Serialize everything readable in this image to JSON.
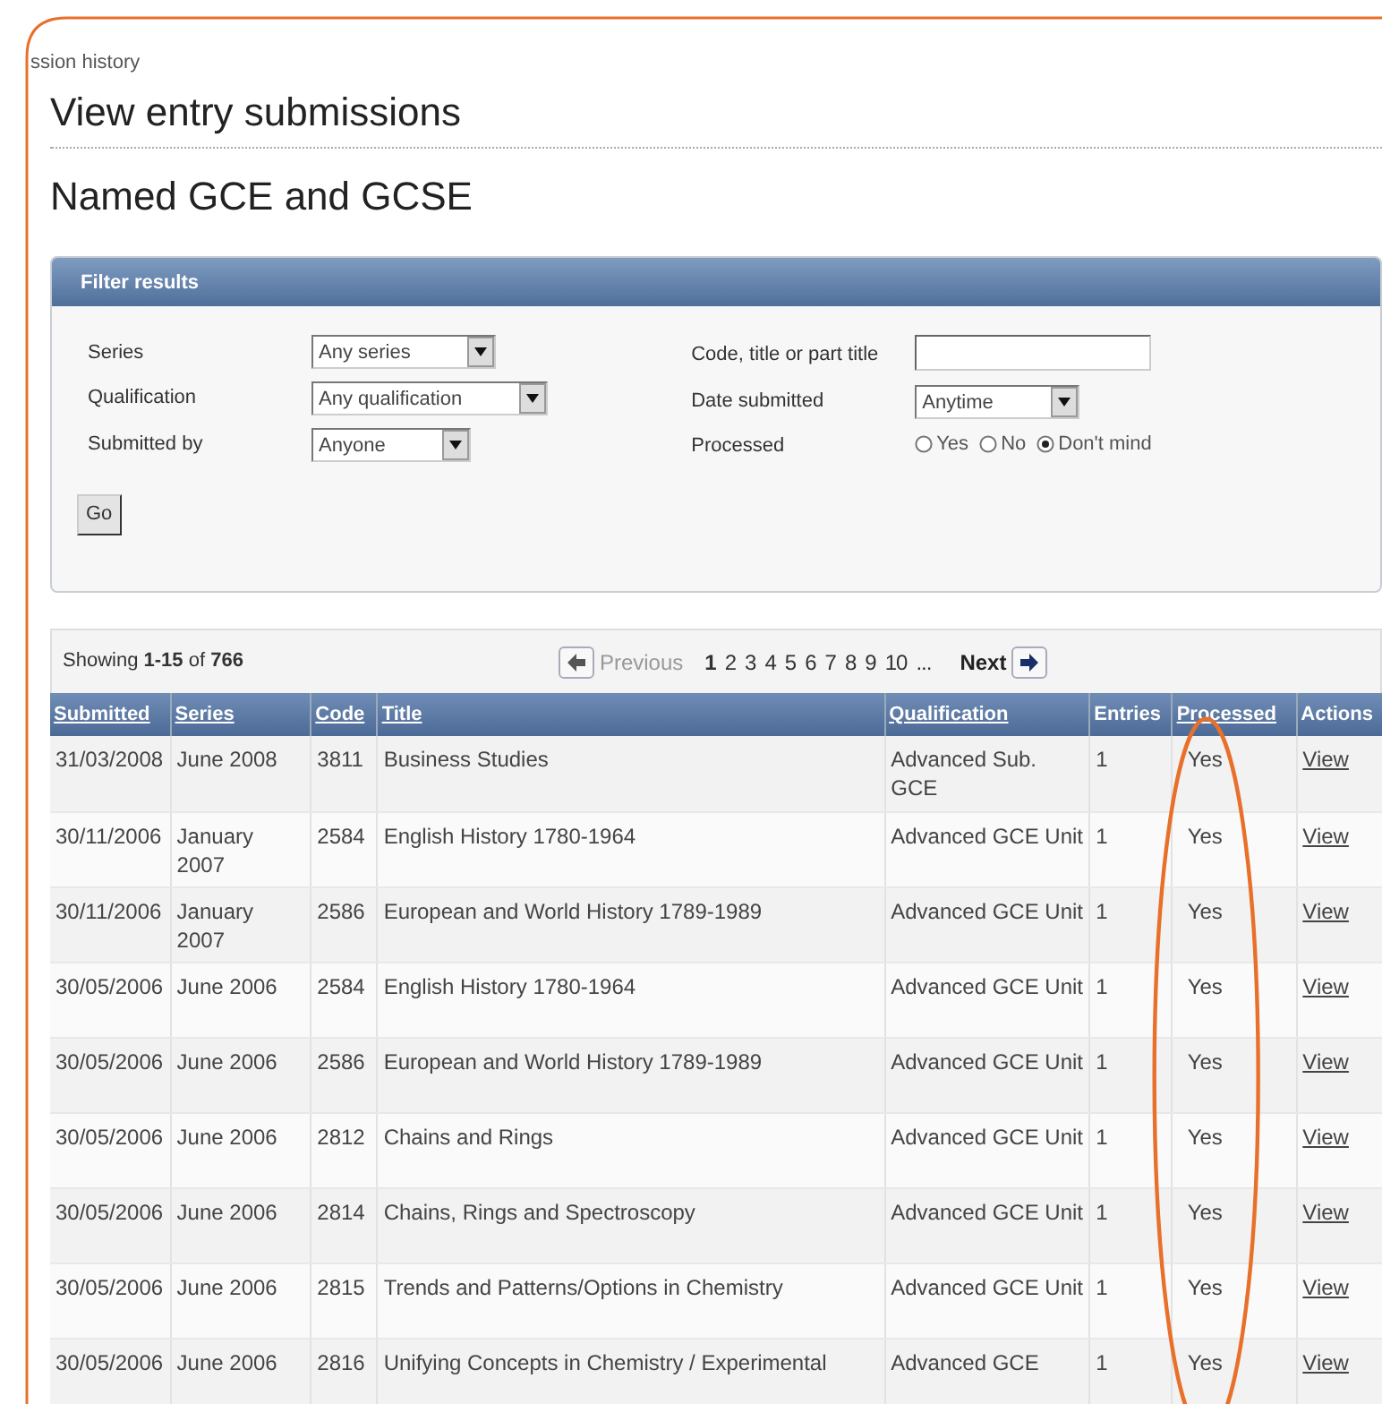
{
  "breadcrumb": "ssion history",
  "title": "View entry submissions",
  "subtitle": "Named GCE and GCSE",
  "filter": {
    "title": "Filter results",
    "left_fields": [
      {
        "label": "Series",
        "value": "Any series"
      },
      {
        "label": "Qualification",
        "value": "Any qualification"
      },
      {
        "label": "Submitted by",
        "value": "Anyone"
      }
    ],
    "code_field": {
      "label": "Code, title or part title"
    },
    "date_field": {
      "label": "Date submitted",
      "value": "Anytime"
    },
    "processed": {
      "label": "Processed",
      "options": [
        {
          "label": "Yes",
          "selected": false
        },
        {
          "label": "No",
          "selected": false
        },
        {
          "label": "Don't mind",
          "selected": true
        }
      ]
    },
    "button": "Go"
  },
  "pagination": {
    "summary": "Showing **1-15** of **766**",
    "previous": {
      "label": "Previous",
      "disabled": true
    },
    "pages": [
      {
        "label": "1",
        "selected": true
      },
      {
        "label": "2",
        "selected": false
      },
      {
        "label": "3",
        "selected": false
      },
      {
        "label": "4",
        "selected": false
      },
      {
        "label": "5",
        "selected": false
      },
      {
        "label": "6",
        "selected": false
      },
      {
        "label": "7",
        "selected": false
      },
      {
        "label": "8",
        "selected": false
      },
      {
        "label": "9",
        "selected": false
      },
      {
        "label": "10",
        "selected": false
      }
    ],
    "ellipsis": "...",
    "next": {
      "label": "Next",
      "disabled": false
    }
  },
  "table": {
    "columns": [
      {
        "label": "Submitted",
        "sortable": true,
        "highlighted": false
      },
      {
        "label": "Series",
        "sortable": true,
        "highlighted": false
      },
      {
        "label": "Code",
        "sortable": true,
        "highlighted": false
      },
      {
        "label": "Title",
        "sortable": true,
        "highlighted": false
      },
      {
        "label": "Qualification",
        "sortable": true,
        "highlighted": false
      },
      {
        "label": "Entries",
        "sortable": false,
        "highlighted": false
      },
      {
        "label": "Processed",
        "sortable": true,
        "highlighted": true
      },
      {
        "label": "Actions",
        "sortable": false,
        "highlighted": false
      }
    ],
    "rows": [
      [
        "31/03/2008",
        "June 2008",
        "3811",
        "Business Studies",
        "Advanced Sub. GCE",
        "1",
        "Yes",
        "View"
      ],
      [
        "30/11/2006",
        "January 2007",
        "2584",
        "English History 1780-1964",
        "Advanced GCE Unit",
        "1",
        "Yes",
        "View"
      ],
      [
        "30/11/2006",
        "January 2007",
        "2586",
        "European and World History 1789-1989",
        "Advanced GCE Unit",
        "1",
        "Yes",
        "View"
      ],
      [
        "30/05/2006",
        "June 2006",
        "2584",
        "English History 1780-1964",
        "Advanced GCE Unit",
        "1",
        "Yes",
        "View"
      ],
      [
        "30/05/2006",
        "June 2006",
        "2586",
        "European and World History 1789-1989",
        "Advanced GCE Unit",
        "1",
        "Yes",
        "View"
      ],
      [
        "30/05/2006",
        "June 2006",
        "2812",
        "Chains and Rings",
        "Advanced GCE Unit",
        "1",
        "Yes",
        "View"
      ],
      [
        "30/05/2006",
        "June 2006",
        "2814",
        "Chains, Rings and Spectroscopy",
        "Advanced GCE Unit",
        "1",
        "Yes",
        "View"
      ],
      [
        "30/05/2006",
        "June 2006",
        "2815",
        "Trends and Patterns/Options in Chemistry",
        "Advanced GCE Unit",
        "1",
        "Yes",
        "View"
      ],
      [
        "30/05/2006",
        "June 2006",
        "2816",
        "Unifying Concepts in Chemistry / Experimental",
        "Advanced GCE",
        "1",
        "Yes",
        "View"
      ]
    ]
  }
}
